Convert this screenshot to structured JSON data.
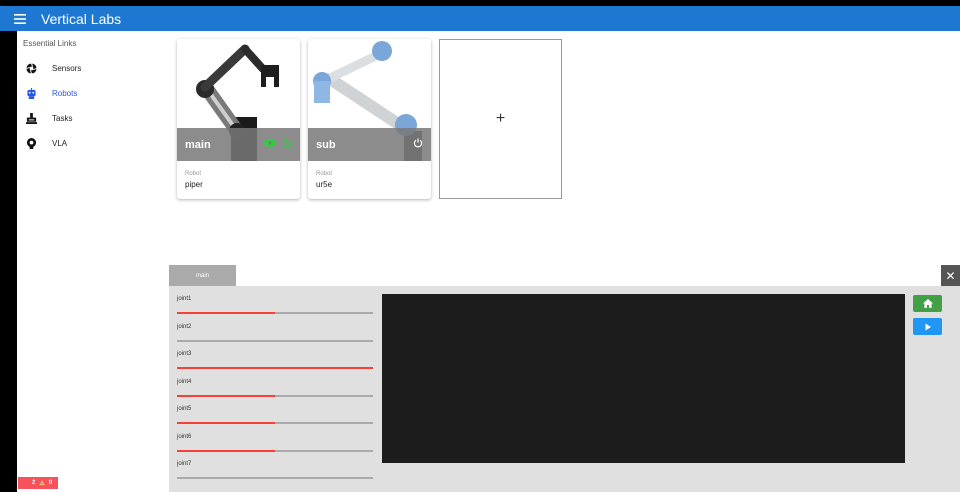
{
  "header": {
    "title": "Vertical Labs"
  },
  "sidebar": {
    "heading": "Essential Links",
    "items": [
      {
        "label": "Sensors",
        "icon": "aperture-icon"
      },
      {
        "label": "Robots",
        "icon": "robot-icon",
        "active": true
      },
      {
        "label": "Tasks",
        "icon": "tasks-icon"
      },
      {
        "label": "VLA",
        "icon": "brain-icon"
      }
    ]
  },
  "status": {
    "errors": "2",
    "warnings": "0"
  },
  "cards": [
    {
      "name": "main",
      "sub_label": "Robot",
      "value": "piper"
    },
    {
      "name": "sub",
      "sub_label": "Robot",
      "value": "ur5e"
    }
  ],
  "add_card": {
    "label": "+"
  },
  "panel": {
    "tab": "main",
    "close_label": "✕",
    "joints": [
      {
        "name": "joint1",
        "level": 0.5
      },
      {
        "name": "joint2",
        "level": 0
      },
      {
        "name": "joint3",
        "level": 1
      },
      {
        "name": "joint4",
        "level": 0.5
      },
      {
        "name": "joint5",
        "level": 0.5
      },
      {
        "name": "joint6",
        "level": 0.5
      },
      {
        "name": "joint7",
        "level": 0
      }
    ]
  },
  "colors": {
    "accent": "#1e78d2",
    "active": "#2757e6",
    "slider": "#f44336",
    "home": "#43a047",
    "play": "#2196f3",
    "error": "#f5525c"
  }
}
